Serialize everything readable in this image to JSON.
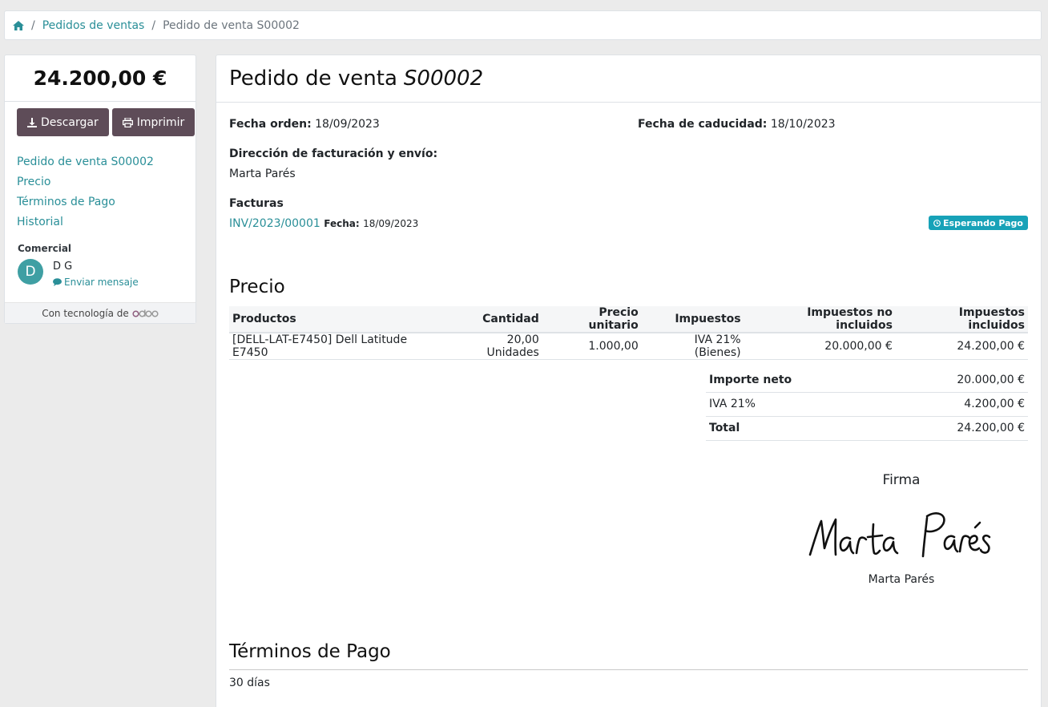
{
  "breadcrumb": {
    "items": [
      "Pedidos de ventas",
      "Pedido de venta S00002"
    ],
    "separator": "/"
  },
  "sidebar": {
    "amount": "24.200,00 €",
    "download_label": "Descargar",
    "print_label": "Imprimir",
    "nav": [
      "Pedido de venta S00002",
      "Precio",
      "Términos de Pago",
      "Historial"
    ],
    "comercial_title": "Comercial",
    "comercial_initial": "D",
    "comercial_name": "D G",
    "send_message": "Enviar mensaje",
    "powered_by": "Con tecnología de",
    "logo_text": "odoo"
  },
  "order": {
    "title_prefix": "Pedido de venta",
    "number": "S00002",
    "fecha_orden_label": "Fecha orden:",
    "fecha_orden": "18/09/2023",
    "fecha_caducidad_label": "Fecha de caducidad:",
    "fecha_caducidad": "18/10/2023",
    "direccion_label": "Dirección de facturación y envío:",
    "direccion": "Marta Parés",
    "facturas_label": "Facturas",
    "invoice": {
      "number": "INV/2023/00001",
      "fecha_label": "Fecha:",
      "fecha": "18/09/2023",
      "status": "Esperando Pago"
    }
  },
  "precio": {
    "heading": "Precio",
    "columns": [
      "Productos",
      "Cantidad",
      "Precio unitario",
      "Impuestos",
      "Impuestos no incluidos",
      "Impuestos incluidos"
    ],
    "rows": [
      {
        "producto": "[DELL-LAT-E7450] Dell Latitude E7450",
        "cantidad": "20,00 Unidades",
        "precio_unitario": "1.000,00",
        "impuestos": "IVA 21% (Bienes)",
        "no_incluidos": "20.000,00 €",
        "incluidos": "24.200,00 €"
      }
    ],
    "totals": [
      {
        "label": "Importe neto",
        "value": "20.000,00 €"
      },
      {
        "label": "IVA 21%",
        "value": "4.200,00 €"
      },
      {
        "label": "Total",
        "value": "24.200,00 €"
      }
    ]
  },
  "firma": {
    "heading": "Firma",
    "signature_text": "Marta Parés",
    "name": "Marta Parés"
  },
  "terminos": {
    "heading": "Términos de Pago",
    "text": "30 días"
  },
  "colors": {
    "link": "#2a8f98",
    "button": "#5e4c58",
    "badge": "#17a2b8",
    "avatar": "#3f9fa3"
  }
}
